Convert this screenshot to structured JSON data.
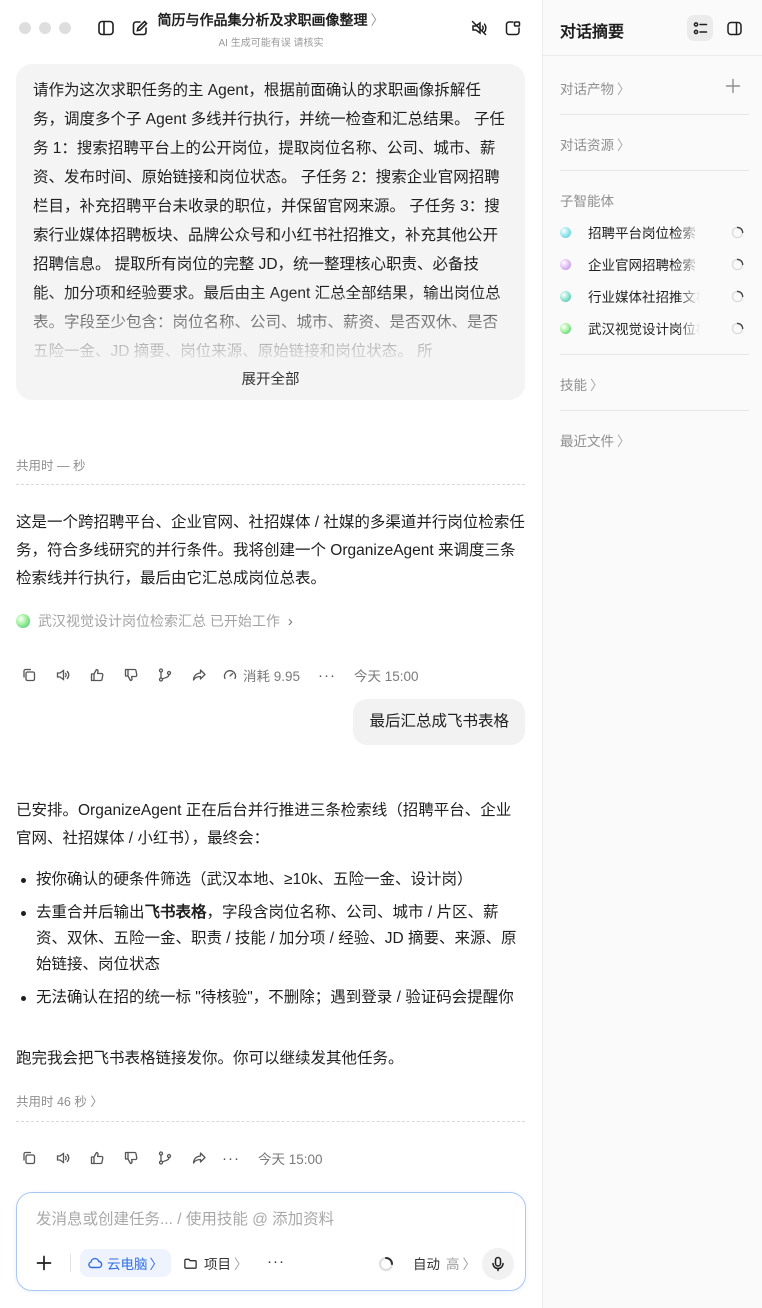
{
  "window": {
    "title": "简历与作品集分析及求职画像整理",
    "title_chevron": "〉",
    "subtitle": "AI 生成可能有误 请核实"
  },
  "icons": {
    "traffic_lights": [
      "close-dot",
      "minimize-dot",
      "zoom-dot"
    ],
    "topbar_left": [
      "sidebar-toggle-icon",
      "new-chat-icon"
    ],
    "topbar_right": [
      "mute-icon",
      "open-window-icon"
    ],
    "panel_header": [
      "summary-list-icon",
      "panel-toggle-icon"
    ]
  },
  "messages": {
    "prompt_text": "请作为这次求职任务的主 Agent，根据前面确认的求职画像拆解任务，调度多个子 Agent 多线并行执行，并统一检查和汇总结果。 子任务 1：搜索招聘平台上的公开岗位，提取岗位名称、公司、城市、薪资、发布时间、原始链接和岗位状态。 子任务 2：搜索企业官网招聘栏目，补充招聘平台未收录的职位，并保留官网来源。 子任务 3：搜索行业媒体招聘板块、品牌公众号和小红书社招推文，补充其他公开招聘信息。 提取所有岗位的完整 JD，统一整理核心职责、必备技能、加分项和经验要求。最后由主 Agent 汇总全部结果，输出岗位总表。字段至少包含：岗位名称、公司、城市、薪资、是否双休、是否五险一金、JD 摘要、岗位来源、原始链接和岗位状态。 所",
    "expand_label": "展开全部",
    "duration_1": "共用时 — 秒",
    "reply_1": "这是一个跨招聘平台、企业官网、社招媒体 / 社媒的多渠道并行岗位检索任务，符合多线研究的并行条件。我将创建一个 OrganizeAgent 来调度三条检索线并行执行，最后由它汇总成岗位总表。",
    "agent_chip_label": "武汉视觉设计岗位检索汇总 已开始工作",
    "actions_1": {
      "cost_label": "消耗 9.95",
      "time_label": "今天 15:00"
    },
    "user_message": "最后汇总成飞书表格",
    "reply_2_intro": "已安排。OrganizeAgent 正在后台并行推进三条检索线（招聘平台、企业官网、社招媒体 / 小红书），最终会：",
    "bullets": {
      "b1": "按你确认的硬条件筛选（武汉本地、≥10k、五险一金、设计岗）",
      "b2_pre": "去重合并后输出",
      "b2_bold": "飞书表格",
      "b2_post": "，字段含岗位名称、公司、城市 / 片区、薪资、双休、五险一金、职责 / 技能 / 加分项 / 经验、JD 摘要、来源、原始链接、岗位状态",
      "b3": "无法确认在招的统一标 \"待核验\"，不删除；遇到登录 / 验证码会提醒你"
    },
    "reply_2_outro": "跑完我会把飞书表格链接发你。你可以继续发其他任务。",
    "duration_2": "共用时 46 秒 〉",
    "actions_2": {
      "time_label": "今天 15:00"
    }
  },
  "action_icons": [
    "copy-icon",
    "speaker-icon",
    "thumbs-up-icon",
    "thumbs-down-icon",
    "branch-icon",
    "share-icon"
  ],
  "composer": {
    "placeholder": "发消息或创建任务... / 使用技能 @ 添加资料",
    "cloud_label": "云电脑",
    "project_label": "项目",
    "chevron": "〉",
    "mode_label": "自动",
    "mode_level": "高",
    "more": "···"
  },
  "panel": {
    "title": "对话摘要",
    "products_label": "对话产物",
    "resources_label": "对话资源",
    "subagents_label": "子智能体",
    "skills_label": "技能",
    "recent_files_label": "最近文件",
    "section_chevron": "〉",
    "subagents": [
      {
        "name": "招聘平台岗位检索",
        "orb_color": "#7fd9e0"
      },
      {
        "name": "企业官网招聘检索",
        "orb_color": "#d7a8f0"
      },
      {
        "name": "行业媒体社招推文检索",
        "orb_color": "#68d3c0"
      },
      {
        "name": "武汉视觉设计岗位检索汇总",
        "orb_color": "#6edb84"
      }
    ]
  },
  "colors": {
    "accent_blue": "#2f6fe0",
    "composer_border": "#a9c8f6",
    "card_bg": "#f4f4f4"
  }
}
